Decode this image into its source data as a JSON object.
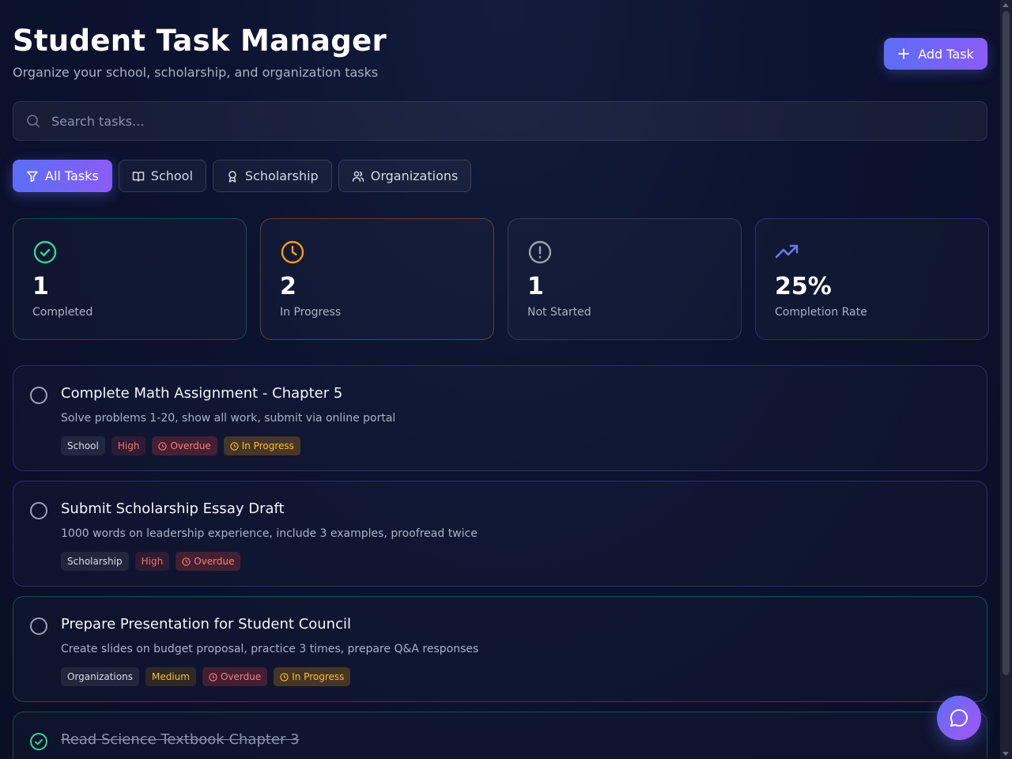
{
  "header": {
    "title": "Student Task Manager",
    "subtitle": "Organize your school, scholarship, and organization tasks",
    "add_label": "Add Task"
  },
  "search": {
    "placeholder": "Search tasks..."
  },
  "filters": [
    {
      "label": "All Tasks",
      "icon": "filter-icon",
      "active": true
    },
    {
      "label": "School",
      "icon": "book-icon",
      "active": false
    },
    {
      "label": "Scholarship",
      "icon": "award-icon",
      "active": false
    },
    {
      "label": "Organizations",
      "icon": "users-icon",
      "active": false
    }
  ],
  "stats": [
    {
      "value": "1",
      "label": "Completed",
      "icon": "check-circle-icon",
      "color": "#34d399"
    },
    {
      "value": "2",
      "label": "In Progress",
      "icon": "clock-icon",
      "color": "#f59e0b"
    },
    {
      "value": "1",
      "label": "Not Started",
      "icon": "alert-circle-icon",
      "color": "#9ca3af"
    },
    {
      "value": "25%",
      "label": "Completion Rate",
      "icon": "trending-up-icon",
      "color": "#6366f1"
    }
  ],
  "tasks": [
    {
      "title": "Complete Math Assignment - Chapter 5",
      "description": "Solve problems 1-20, show all work, submit via online portal",
      "category": "School",
      "priority": "High",
      "overdue": "Overdue",
      "status": "In Progress",
      "completed": false
    },
    {
      "title": "Submit Scholarship Essay Draft",
      "description": "1000 words on leadership experience, include 3 examples, proofread twice",
      "category": "Scholarship",
      "priority": "High",
      "overdue": "Overdue",
      "status": "",
      "completed": false
    },
    {
      "title": "Prepare Presentation for Student Council",
      "description": "Create slides on budget proposal, practice 3 times, prepare Q&A responses",
      "category": "Organizations",
      "priority": "Medium",
      "overdue": "Overdue",
      "status": "In Progress",
      "completed": false
    },
    {
      "title": "Read Science Textbook Chapter 3",
      "completed": true
    }
  ],
  "colors": {
    "accent_start": "#5b6ef5",
    "accent_end": "#8b5cf6",
    "background": "#0c1330"
  }
}
